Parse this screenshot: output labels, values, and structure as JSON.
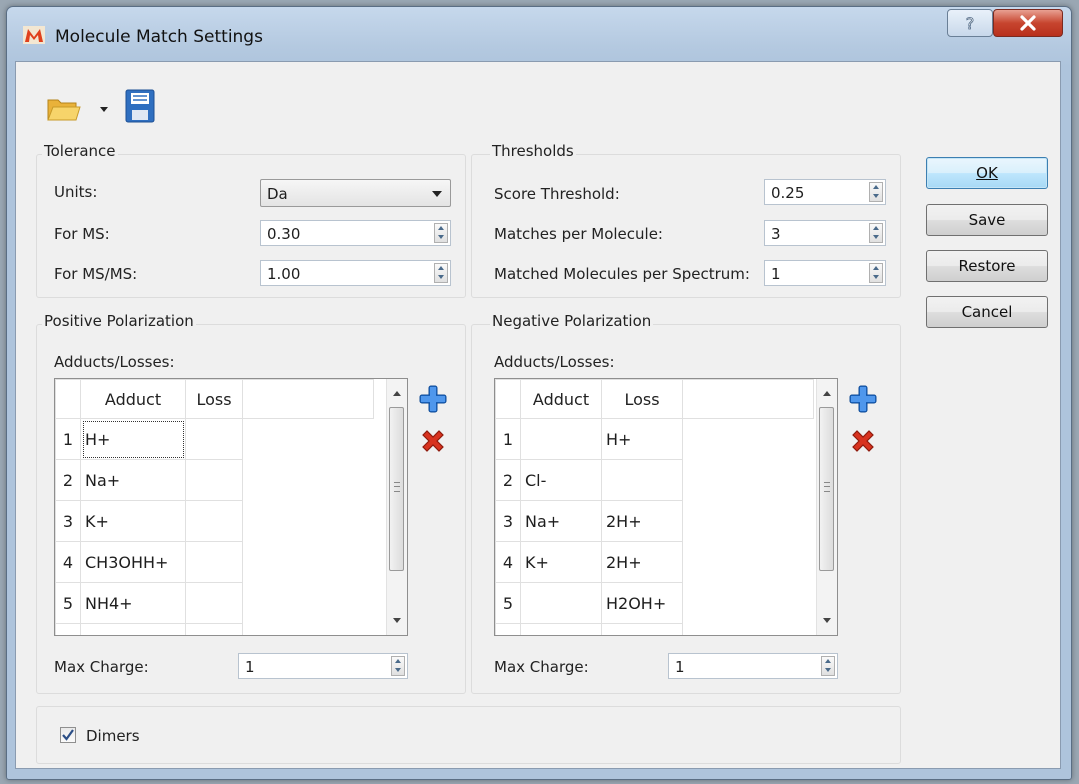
{
  "window": {
    "title": "Molecule Match Settings"
  },
  "icons": {
    "app": "molecule-app-icon",
    "help": "help-icon",
    "close": "close-icon",
    "open": "open-folder-icon",
    "save": "floppy-disk-icon",
    "add": "plus-icon",
    "remove": "delete-x-icon"
  },
  "tolerance": {
    "title": "Tolerance",
    "units_label": "Units:",
    "units_value": "Da",
    "ms_label": "For MS:",
    "ms_value": "0.30",
    "msms_label": "For MS/MS:",
    "msms_value": "1.00"
  },
  "thresholds": {
    "title": "Thresholds",
    "score_label": "Score Threshold:",
    "score_value": "0.25",
    "matches_label": "Matches per Molecule:",
    "matches_value": "3",
    "matched_label": "Matched Molecules per Spectrum:",
    "matched_value": "1"
  },
  "positive": {
    "title": "Positive Polarization",
    "adducts_label": "Adducts/Losses:",
    "columns": [
      "Adduct",
      "Loss"
    ],
    "rows": [
      {
        "n": "1",
        "adduct": "H+",
        "loss": ""
      },
      {
        "n": "2",
        "adduct": "Na+",
        "loss": ""
      },
      {
        "n": "3",
        "adduct": "K+",
        "loss": ""
      },
      {
        "n": "4",
        "adduct": "CH3OHH+",
        "loss": ""
      },
      {
        "n": "5",
        "adduct": "NH4+",
        "loss": ""
      }
    ],
    "max_charge_label": "Max Charge:",
    "max_charge_value": "1"
  },
  "negative": {
    "title": "Negative Polarization",
    "adducts_label": "Adducts/Losses:",
    "columns": [
      "Adduct",
      "Loss"
    ],
    "rows": [
      {
        "n": "1",
        "adduct": "",
        "loss": "H+"
      },
      {
        "n": "2",
        "adduct": "Cl-",
        "loss": ""
      },
      {
        "n": "3",
        "adduct": "Na+",
        "loss": "2H+"
      },
      {
        "n": "4",
        "adduct": "K+",
        "loss": "2H+"
      },
      {
        "n": "5",
        "adduct": "",
        "loss": "H2OH+"
      }
    ],
    "max_charge_label": "Max Charge:",
    "max_charge_value": "1"
  },
  "dimers": {
    "label": "Dimers",
    "checked": true
  },
  "buttons": {
    "ok_label": "OK",
    "save_label": "Save",
    "restore_label": "Restore",
    "cancel_label": "Cancel"
  }
}
